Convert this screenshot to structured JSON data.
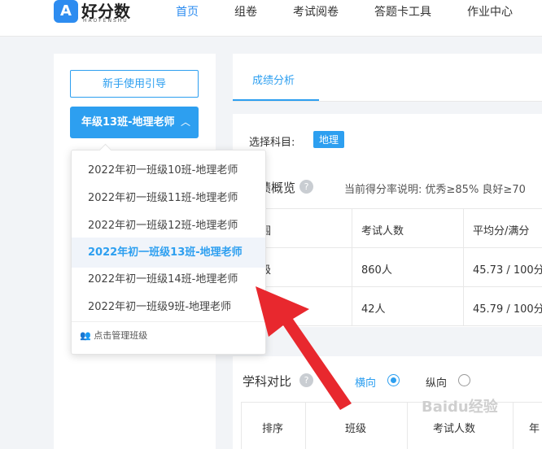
{
  "header": {
    "logo_text": "好分数",
    "logo_sub": "HAOFENSHU",
    "nav": [
      "首页",
      "组卷",
      "考试阅卷",
      "答题卡工具",
      "作业中心"
    ]
  },
  "left": {
    "guide_label": "新手使用引导",
    "current_class": "年级13班-地理老师"
  },
  "dropdown": {
    "items": [
      "2022年初一班级10班-地理老师",
      "2022年初一班级11班-地理老师",
      "2022年初一班级12班-地理老师",
      "2022年初一班级13班-地理老师",
      "2022年初一班级14班-地理老师",
      "2022年初一班级9班-地理老师"
    ],
    "selected_index": 3,
    "manage_label": "点击管理班级"
  },
  "main": {
    "tab_label": "成绩分析",
    "subject_label": "选择科目:",
    "subject_value": "地理",
    "overview_title": "绩概览",
    "score_note": "当前得分率说明:  优秀≥85%  良好≥70",
    "table_headers": [
      "围",
      "考试人数",
      "平均分/满分"
    ],
    "table_rows": [
      [
        "级",
        "860人",
        "45.73 / 100分"
      ],
      [
        "",
        "42人",
        "45.79 / 100分"
      ]
    ],
    "compare_title": "学科对比",
    "horizontal_label": "横向",
    "vertical_label": "纵向",
    "compare_headers": [
      "排序",
      "班级",
      "考试人数",
      "年"
    ]
  },
  "watermark": "Baidu经验",
  "colors": {
    "accent": "#2d9ff0",
    "arrow": "#e8282e"
  }
}
